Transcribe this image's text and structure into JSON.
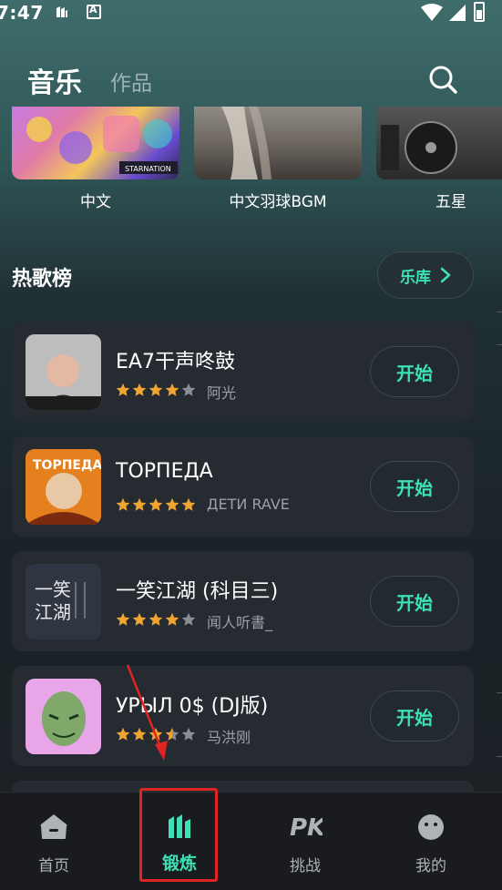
{
  "status_bar": {
    "time": "7:47",
    "icon_b": "A"
  },
  "header": {
    "title": "音乐",
    "secondary_tab": "作品"
  },
  "carousel": [
    {
      "label": "中文"
    },
    {
      "label": "中文羽球BGM"
    },
    {
      "label": "五星"
    }
  ],
  "hot_songs": {
    "title": "热歌榜",
    "library_label": "乐库",
    "items": [
      {
        "title": "EA7干声咚鼓",
        "artist": "阿光",
        "stars": 4,
        "action": "开始"
      },
      {
        "title": "ТОРПЕДА",
        "artist": "ДЕТИ RAVE",
        "stars": 5,
        "action": "开始"
      },
      {
        "title": "一笑江湖 (科目三)",
        "artist": "闻人听書_",
        "stars": 4,
        "action": "开始"
      },
      {
        "title": "УРЫЛ 0$ (DJ版)",
        "artist": "马洪刚",
        "stars": 3.5,
        "action": "开始"
      }
    ]
  },
  "bottom_nav": [
    {
      "label": "首页",
      "icon": "home-icon"
    },
    {
      "label": "锻炼",
      "icon": "workout-icon",
      "active": true
    },
    {
      "label": "挑战",
      "icon": "pk-icon"
    },
    {
      "label": "我的",
      "icon": "profile-icon"
    }
  ],
  "colors": {
    "accent": "#3de1b5",
    "card_bg": "#262b31",
    "star": "#f0a531",
    "highlight": "#e02424"
  }
}
